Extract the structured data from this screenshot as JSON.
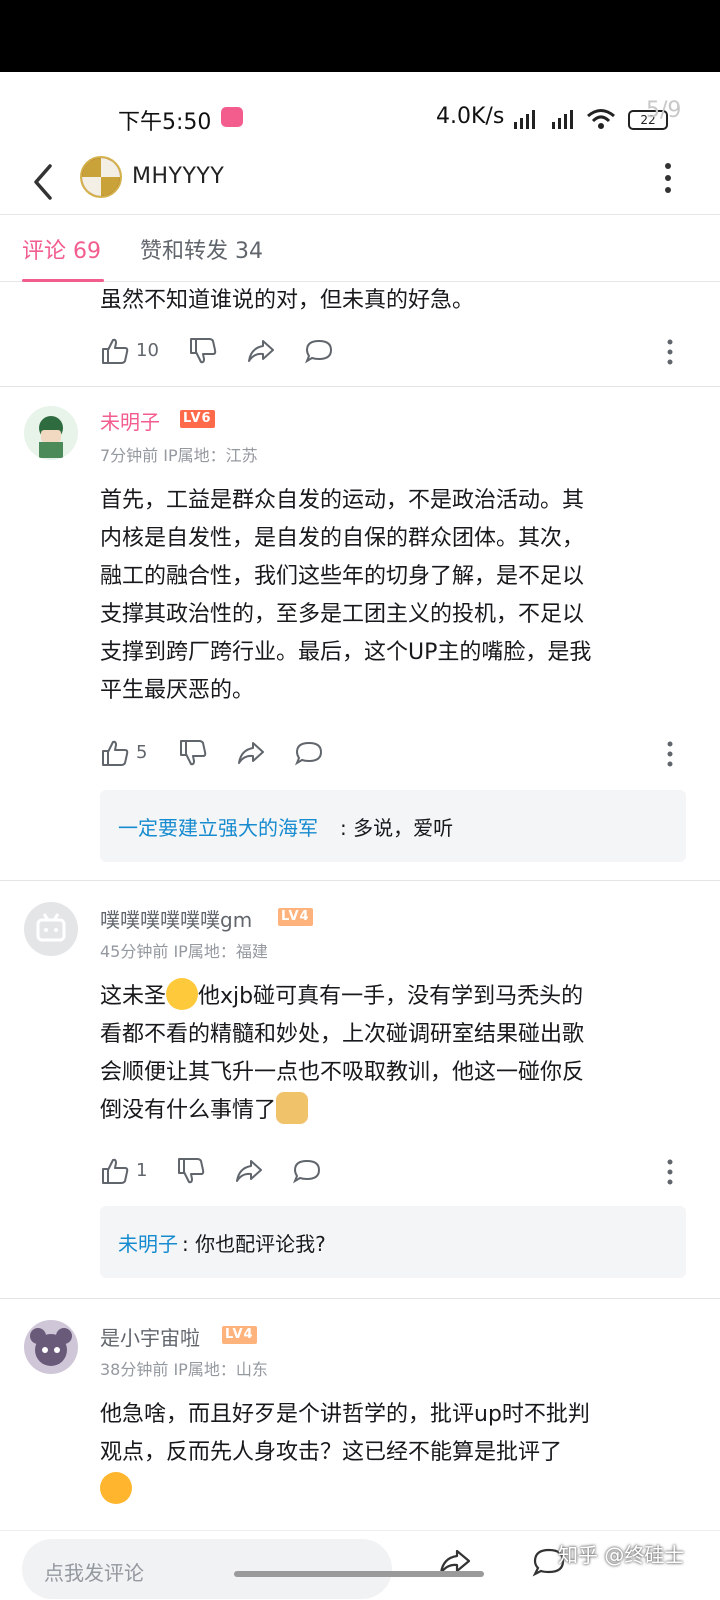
{
  "status_bar": {
    "time": "下午5:50",
    "network_speed": "4.0K/s",
    "battery": "22",
    "page_indicator": "5/9"
  },
  "nav": {
    "username": "MHYYYY"
  },
  "tabs": [
    {
      "label": "评论 69"
    },
    {
      "label": "赞和转发 34"
    }
  ],
  "comments": [
    {
      "text": "虽然不知道谁说的对，但未真的好急。",
      "likes": "10"
    },
    {
      "name": "未明子",
      "level": "LV6",
      "meta": "7分钟前  IP属地：江苏",
      "lines": [
        "首先，工益是群众自发的运动，不是政治活动。其",
        "内核是自发性，是自发的自保的群众团体。其次，",
        "融工的融合性，我们这些年的切身了解，是不足以",
        "支撑其政治性的，至多是工团主义的投机，不足以",
        "支撑到跨厂跨行业。最后，这个UP主的嘴脸，是我",
        "平生最厌恶的。"
      ],
      "likes": "5",
      "reply": {
        "name": "一定要建立强大的海军",
        "text": ": 多说，爱听"
      }
    },
    {
      "name": "噗噗噗噗噗噗gm",
      "level": "LV4",
      "meta": "45分钟前  IP属地：福建",
      "line1_a": "这未圣",
      "line1_b": "他xjb碰可真有一手，没有学到马秃头的",
      "lines": [
        "看都不看的精髓和妙处，上次碰调研室结果碰出歌",
        "会顺便让其飞升一点也不吸取教训，他这一碰你反"
      ],
      "line_last": "倒没有什么事情了",
      "likes": "1",
      "reply": {
        "name": "未明子",
        "text": ": 你也配评论我?"
      }
    },
    {
      "name": "是小宇宙啦",
      "level": "LV4",
      "meta": "38分钟前  IP属地：山东",
      "lines": [
        "他急啥，而且好歹是个讲哲学的，批评up时不批判",
        "观点，反而先人身攻击？这已经不能算是批评了"
      ]
    }
  ],
  "bottom_bar": {
    "placeholder": "点我发评论",
    "watermark": "知乎 @终硅士"
  }
}
